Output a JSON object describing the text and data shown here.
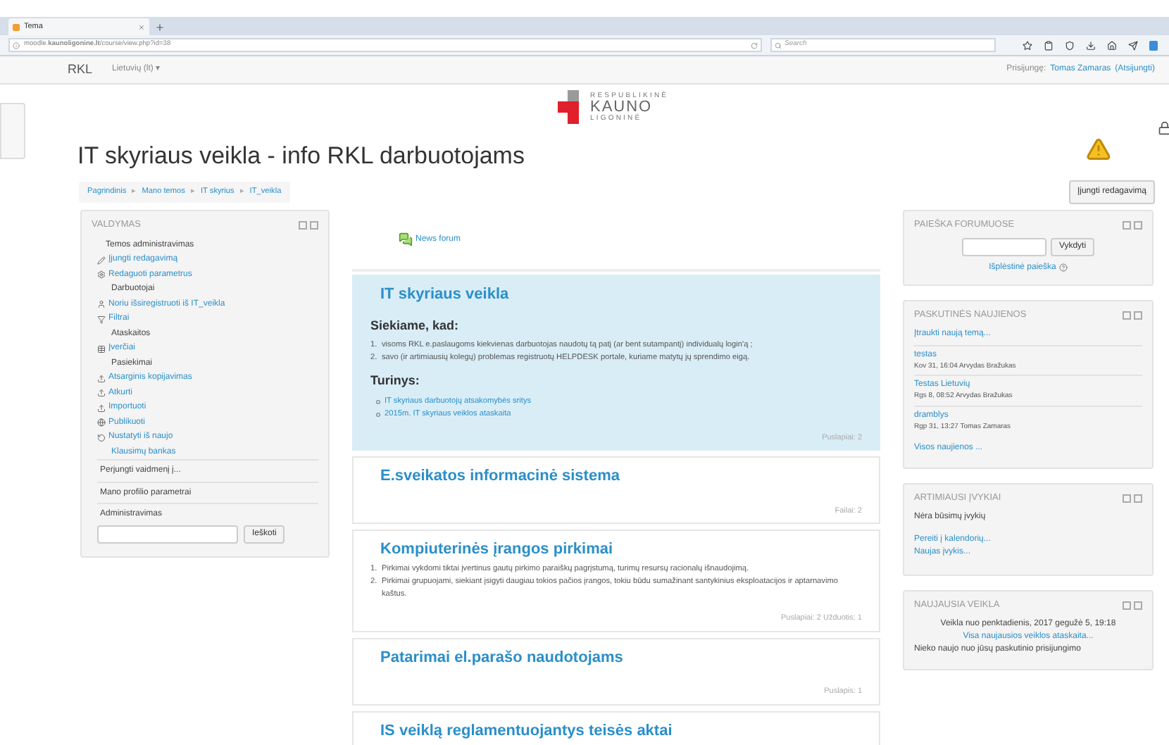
{
  "browser": {
    "tab_title": "Tema",
    "url": "moodle.**kaunoligonine.lt**/course/view.php?id=38",
    "search_placeholder": "Search"
  },
  "navbar": {
    "brand": "RKL",
    "language": "Lietuvių (lt) ▾",
    "login_prefix": "Prisijungę:",
    "user": "Tomas Zamaras",
    "logout": "(Atsijungti)"
  },
  "logo": {
    "lines": [
      "RESPUBLIKINĖ",
      "KAUNO",
      "LIGONINĖ"
    ]
  },
  "page_title": "IT skyriaus veikla - info RKL darbuotojams",
  "breadcrumb": {
    "separator": "▸",
    "items": [
      "Pagrindinis",
      "Mano temos",
      "IT skyrius",
      "IT_veikla"
    ]
  },
  "edit_button": "Įjungti redagavimą",
  "admin_block": {
    "title": "VALDYMAS",
    "heading": "Temos administravimas",
    "items": [
      {
        "kind": "link",
        "label": "Įjungti redagavimą"
      },
      {
        "kind": "link",
        "label": "Redaguoti parametrus"
      },
      {
        "kind": "section",
        "label": "Darbuotojai"
      },
      {
        "kind": "link",
        "label": "Noriu išsiregistruoti iš IT_veikla"
      },
      {
        "kind": "link",
        "label": "Filtrai"
      },
      {
        "kind": "section",
        "label": "Ataskaitos"
      },
      {
        "kind": "link",
        "label": "Įverčiai"
      },
      {
        "kind": "section",
        "label": "Pasiekimai"
      },
      {
        "kind": "link",
        "label": "Atsarginis kopijavimas"
      },
      {
        "kind": "link",
        "label": "Atkurti"
      },
      {
        "kind": "link",
        "label": "Importuoti"
      },
      {
        "kind": "link",
        "label": "Publikuoti"
      },
      {
        "kind": "link",
        "label": "Nustatyti iš naujo"
      },
      {
        "kind": "sublink",
        "label": "Klausimų bankas"
      }
    ],
    "footer_items": [
      "Perjungti vaidmenį į...",
      "Mano profilio parametrai",
      "Administravimas"
    ],
    "search_button": "Ieškoti"
  },
  "news_forum": "News forum",
  "sections": [
    {
      "title": "IT skyriaus veikla",
      "highlighted": true,
      "blocks": [
        {
          "kind": "heading",
          "text": "Siekiame, kad:"
        },
        {
          "kind": "ordered",
          "items": [
            {
              "number": "1.",
              "text": "visoms RKL e.paslaugoms kiekvienas darbuotojas naudotų tą patį (ar bent sutampantį) individualų login'ą ;"
            },
            {
              "number": "2.",
              "text": "savo (ir artimiausių kolegų) problemas registruotų HELPDESK portale, kuriame matytų jų sprendimo eigą."
            }
          ]
        },
        {
          "kind": "heading",
          "text": "Turinys:"
        },
        {
          "kind": "bullets",
          "items": [
            "IT skyriaus darbuotojų atsakomybės sritys",
            "2015m. IT skyriaus veiklos ataskaita"
          ]
        }
      ],
      "footer": "Puslapiai: 2"
    },
    {
      "title": "E.sveikatos informacinė sistema",
      "highlighted": false,
      "footer": "Failai: 2"
    },
    {
      "title": "Kompiuterinės įrangos pirkimai",
      "highlighted": false,
      "blocks": [
        {
          "kind": "ordered",
          "items": [
            {
              "number": "1.",
              "text": "Pirkimai vykdomi tiktai įvertinus gautų pirkimo paraiškų pagrįstumą, turimų resursų racionalų išnaudojimą."
            },
            {
              "number": "2.",
              "text": "Pirkimai grupuojami, siekiant įsigyti daugiau tokios pačios įrangos, tokiu būdu sumažinant santykinius eksploatacijos ir aptarnavimo kaštus."
            }
          ]
        }
      ],
      "footer": "Puslapiai: 2 Užduotis: 1"
    },
    {
      "title": "Patarimai el.parašo naudotojams",
      "highlighted": false,
      "footer": "Puslapis: 1"
    },
    {
      "title": "IS veiklą reglamentuojantys teisės aktai",
      "highlighted": false
    }
  ],
  "forum_search": {
    "title": "PAIEŠKA FORUMUOSE",
    "button": "Vykdyti",
    "advanced": "Išplėstinė paieška"
  },
  "latest_news": {
    "title": "PASKUTINĖS NAUJIENOS",
    "add": "Įtraukti naują temą...",
    "posts": [
      {
        "title": "testas",
        "meta": "Kov 31, 16:04  Arvydas Bražukas"
      },
      {
        "title": "Testas Lietuvių",
        "meta": "Rgs 8, 08:52  Arvydas Bražukas"
      },
      {
        "title": "dramblys",
        "meta": "Rgp 31, 13:27  Tomas Zamaras"
      }
    ],
    "all": "Visos naujienos ..."
  },
  "upcoming": {
    "title": "ARTIMIAUSI ĮVYKIAI",
    "empty": "Nėra būsimų įvykių",
    "links": [
      "Pereiti į kalendorių...",
      "Naujas įvykis..."
    ]
  },
  "recent": {
    "title": "NAUJAUSIA VEIKLA",
    "since": "Veikla nuo penktadienis, 2017 gegužė 5, 19:18",
    "report": "Visa naujausios veiklos ataskaita...",
    "nothing": "Nieko naujo nuo jūsų paskutinio prisijungimo"
  }
}
